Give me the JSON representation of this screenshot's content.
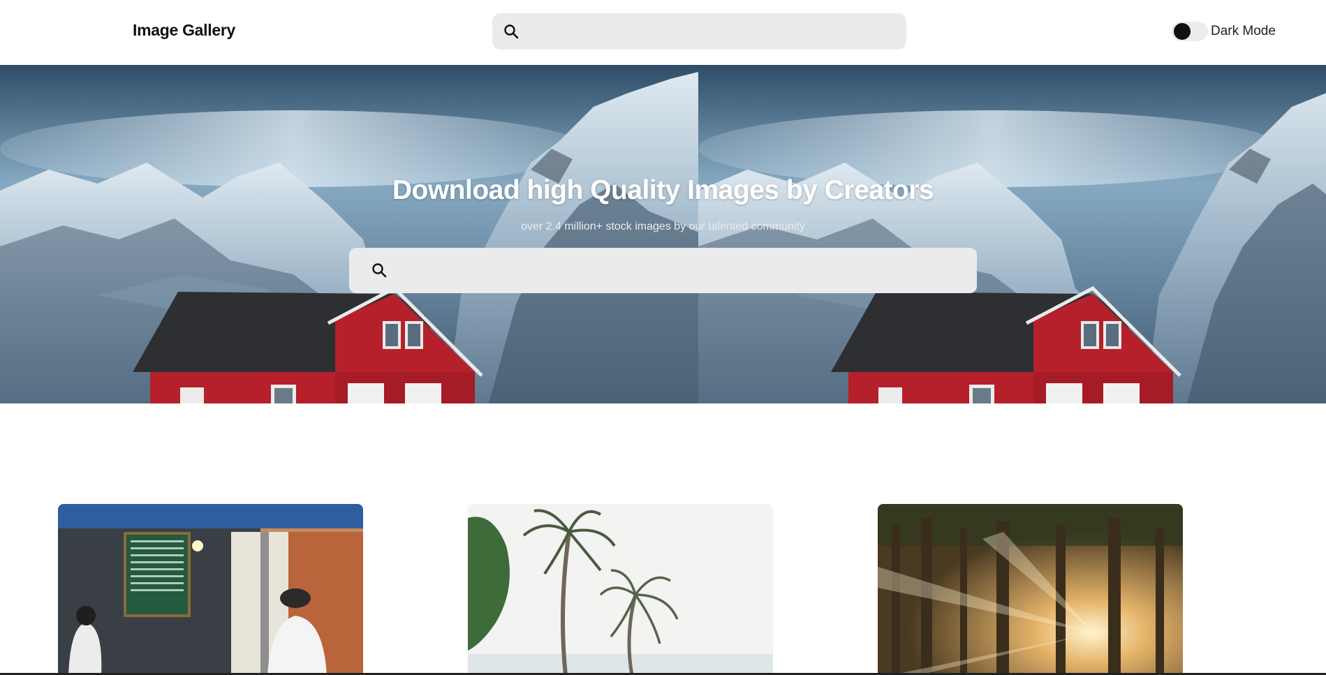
{
  "header": {
    "logo": "Image Gallery",
    "search_icon": "search-icon",
    "search_placeholder": "",
    "dark_mode_label": "Dark Mode",
    "dark_mode_on": false
  },
  "hero": {
    "title": "Download high Quality Images by Creators",
    "subtitle": "over 2.4 million+ stock images by our talented community",
    "search_icon": "search-icon",
    "search_placeholder": ""
  },
  "gallery": {
    "images": [
      {
        "name": "street-food-stall-photo"
      },
      {
        "name": "palm-trees-photo"
      },
      {
        "name": "sunlit-forest-photo"
      }
    ]
  },
  "colors": {
    "search_bg": "#ebebeb",
    "toggle_knob": "#111111",
    "house_red": "#b5202a"
  }
}
